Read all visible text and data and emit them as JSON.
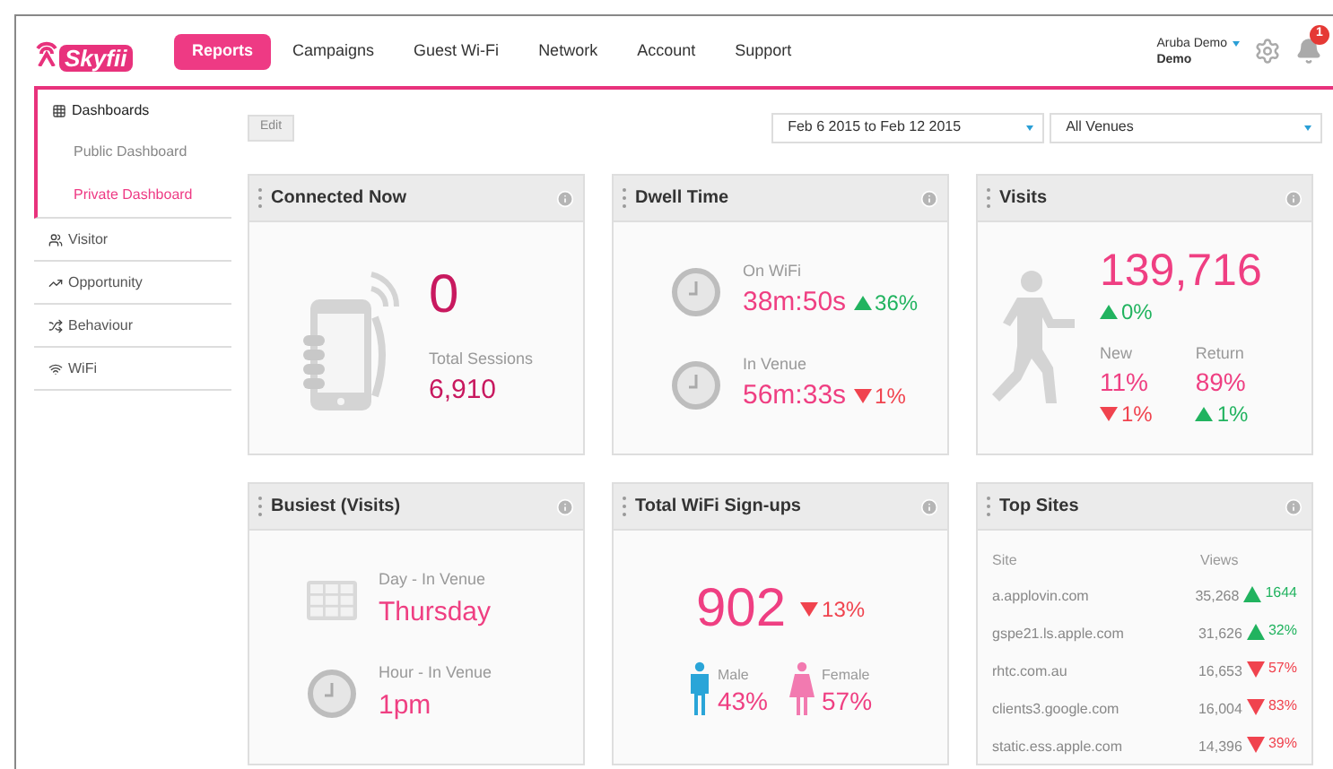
{
  "logo": {
    "text": "Skyfii"
  },
  "nav": [
    {
      "label": "Reports",
      "selected": true
    },
    {
      "label": "Campaigns",
      "selected": false
    },
    {
      "label": "Guest Wi-Fi",
      "selected": false
    },
    {
      "label": "Network",
      "selected": false
    },
    {
      "label": "Account",
      "selected": false
    },
    {
      "label": "Support",
      "selected": false
    }
  ],
  "user": {
    "name": "Aruba Demo",
    "org": "Demo"
  },
  "notifications": {
    "count": "1"
  },
  "sidebar": {
    "items": [
      {
        "label": "Dashboards",
        "expanded": true,
        "children": [
          {
            "label": "Public Dashboard",
            "selected": false
          },
          {
            "label": "Private Dashboard",
            "selected": true
          }
        ]
      },
      {
        "label": "Visitor",
        "expanded": false
      },
      {
        "label": "Opportunity",
        "expanded": false
      },
      {
        "label": "Behaviour",
        "expanded": false
      },
      {
        "label": "WiFi",
        "expanded": false
      }
    ]
  },
  "toolbar": {
    "edit": "Edit",
    "date_range": "Feb 6 2015 to Feb 12 2015",
    "venue": "All Venues"
  },
  "cards": [
    {
      "kind": "connected",
      "title": "Connected Now",
      "value": "0",
      "sub_label": "Total Sessions",
      "sub_value": "6,910"
    },
    {
      "kind": "dwell",
      "title": "Dwell Time",
      "rows": [
        {
          "label": "On WiFi",
          "value": "38m:50s",
          "change": {
            "up": true,
            "text": "36%"
          }
        },
        {
          "label": "In Venue",
          "value": "56m:33s",
          "change": {
            "up": false,
            "text": "1%"
          }
        }
      ]
    },
    {
      "kind": "visits",
      "title": "Visits",
      "total": "139,716",
      "change": {
        "up": true,
        "text": "0%"
      },
      "segments": [
        {
          "label": "New",
          "value": "11%",
          "change": {
            "up": false,
            "text": "1%"
          }
        },
        {
          "label": "Return",
          "value": "89%",
          "change": {
            "up": true,
            "text": "1%"
          }
        }
      ]
    },
    {
      "kind": "busiest",
      "title": "Busiest (Visits)",
      "rows": [
        {
          "label": "Day - In Venue",
          "value": "Thursday"
        },
        {
          "label": "Hour - In Venue",
          "value": "1pm"
        }
      ]
    },
    {
      "kind": "signups",
      "title": "Total WiFi Sign-ups",
      "total": "902",
      "change": {
        "up": false,
        "text": "13%"
      },
      "genders": [
        {
          "label": "Male",
          "value": "43%"
        },
        {
          "label": "Female",
          "value": "57%"
        }
      ]
    },
    {
      "kind": "top_sites",
      "title": "Top Sites",
      "columns": [
        "Site",
        "Views"
      ],
      "rows": [
        {
          "site": "a.applovin.com",
          "views": "35,268",
          "change": {
            "up": true,
            "text": "1644"
          }
        },
        {
          "site": "gspe21.ls.apple.com",
          "views": "31,626",
          "change": {
            "up": true,
            "text": "32%"
          }
        },
        {
          "site": "rhtc.com.au",
          "views": "16,653",
          "change": {
            "up": false,
            "text": "57%"
          }
        },
        {
          "site": "clients3.google.com",
          "views": "16,004",
          "change": {
            "up": false,
            "text": "83%"
          }
        },
        {
          "site": "static.ess.apple.com",
          "views": "14,396",
          "change": {
            "up": false,
            "text": "39%"
          }
        }
      ]
    }
  ]
}
